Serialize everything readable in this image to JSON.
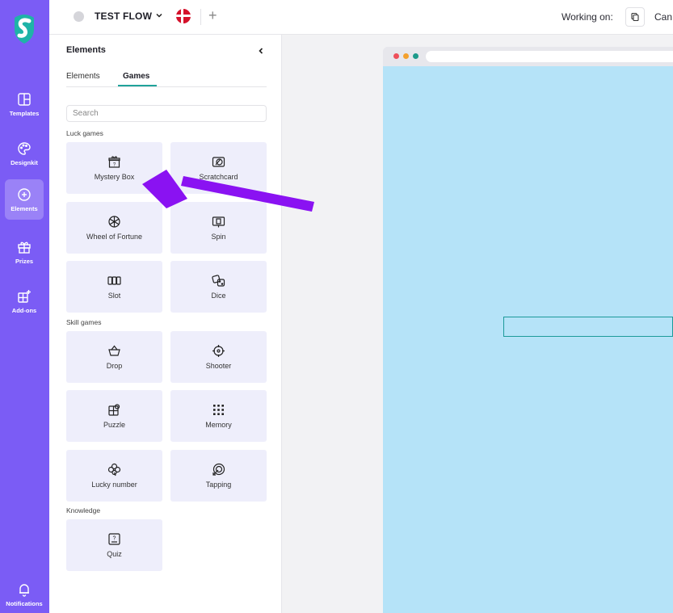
{
  "rail": {
    "items": [
      {
        "label": "Templates"
      },
      {
        "label": "Designkit"
      },
      {
        "label": "Elements"
      },
      {
        "label": "Prizes"
      },
      {
        "label": "Add-ons"
      }
    ],
    "bottom": {
      "label": "Notifications"
    },
    "accent": "#7b5cf5"
  },
  "topbar": {
    "project_name": "TEST FLOW",
    "plus": "+",
    "working_label": "Working on:",
    "can_text": "Can"
  },
  "panel": {
    "title": "Elements",
    "tabs": [
      {
        "label": "Elements",
        "active": false
      },
      {
        "label": "Games",
        "active": true
      }
    ],
    "search_placeholder": "Search",
    "sections": {
      "luck": "Luck games",
      "skill": "Skill games",
      "knowledge": "Knowledge"
    },
    "luck_games": [
      {
        "label": "Mystery Box",
        "icon": "gift-icon"
      },
      {
        "label": "Scratchcard",
        "icon": "scratchcard-icon"
      },
      {
        "label": "Wheel of Fortune",
        "icon": "wheel-icon"
      },
      {
        "label": "Spin",
        "icon": "spin-icon"
      },
      {
        "label": "Slot",
        "icon": "slot-icon"
      },
      {
        "label": "Dice",
        "icon": "dice-icon"
      }
    ],
    "skill_games": [
      {
        "label": "Drop",
        "icon": "basket-icon"
      },
      {
        "label": "Shooter",
        "icon": "crosshair-icon"
      },
      {
        "label": "Puzzle",
        "icon": "puzzle-icon"
      },
      {
        "label": "Memory",
        "icon": "grid-dots-icon"
      },
      {
        "label": "Lucky number",
        "icon": "clover-icon"
      },
      {
        "label": "Tapping",
        "icon": "tap-target-icon"
      }
    ],
    "knowledge_games": [
      {
        "label": "Quiz",
        "icon": "quiz-icon"
      }
    ]
  },
  "colors": {
    "canvas_bg": "#b5e3f8",
    "annotation_arrow": "#8a12f2",
    "teal": "#20a39a"
  }
}
